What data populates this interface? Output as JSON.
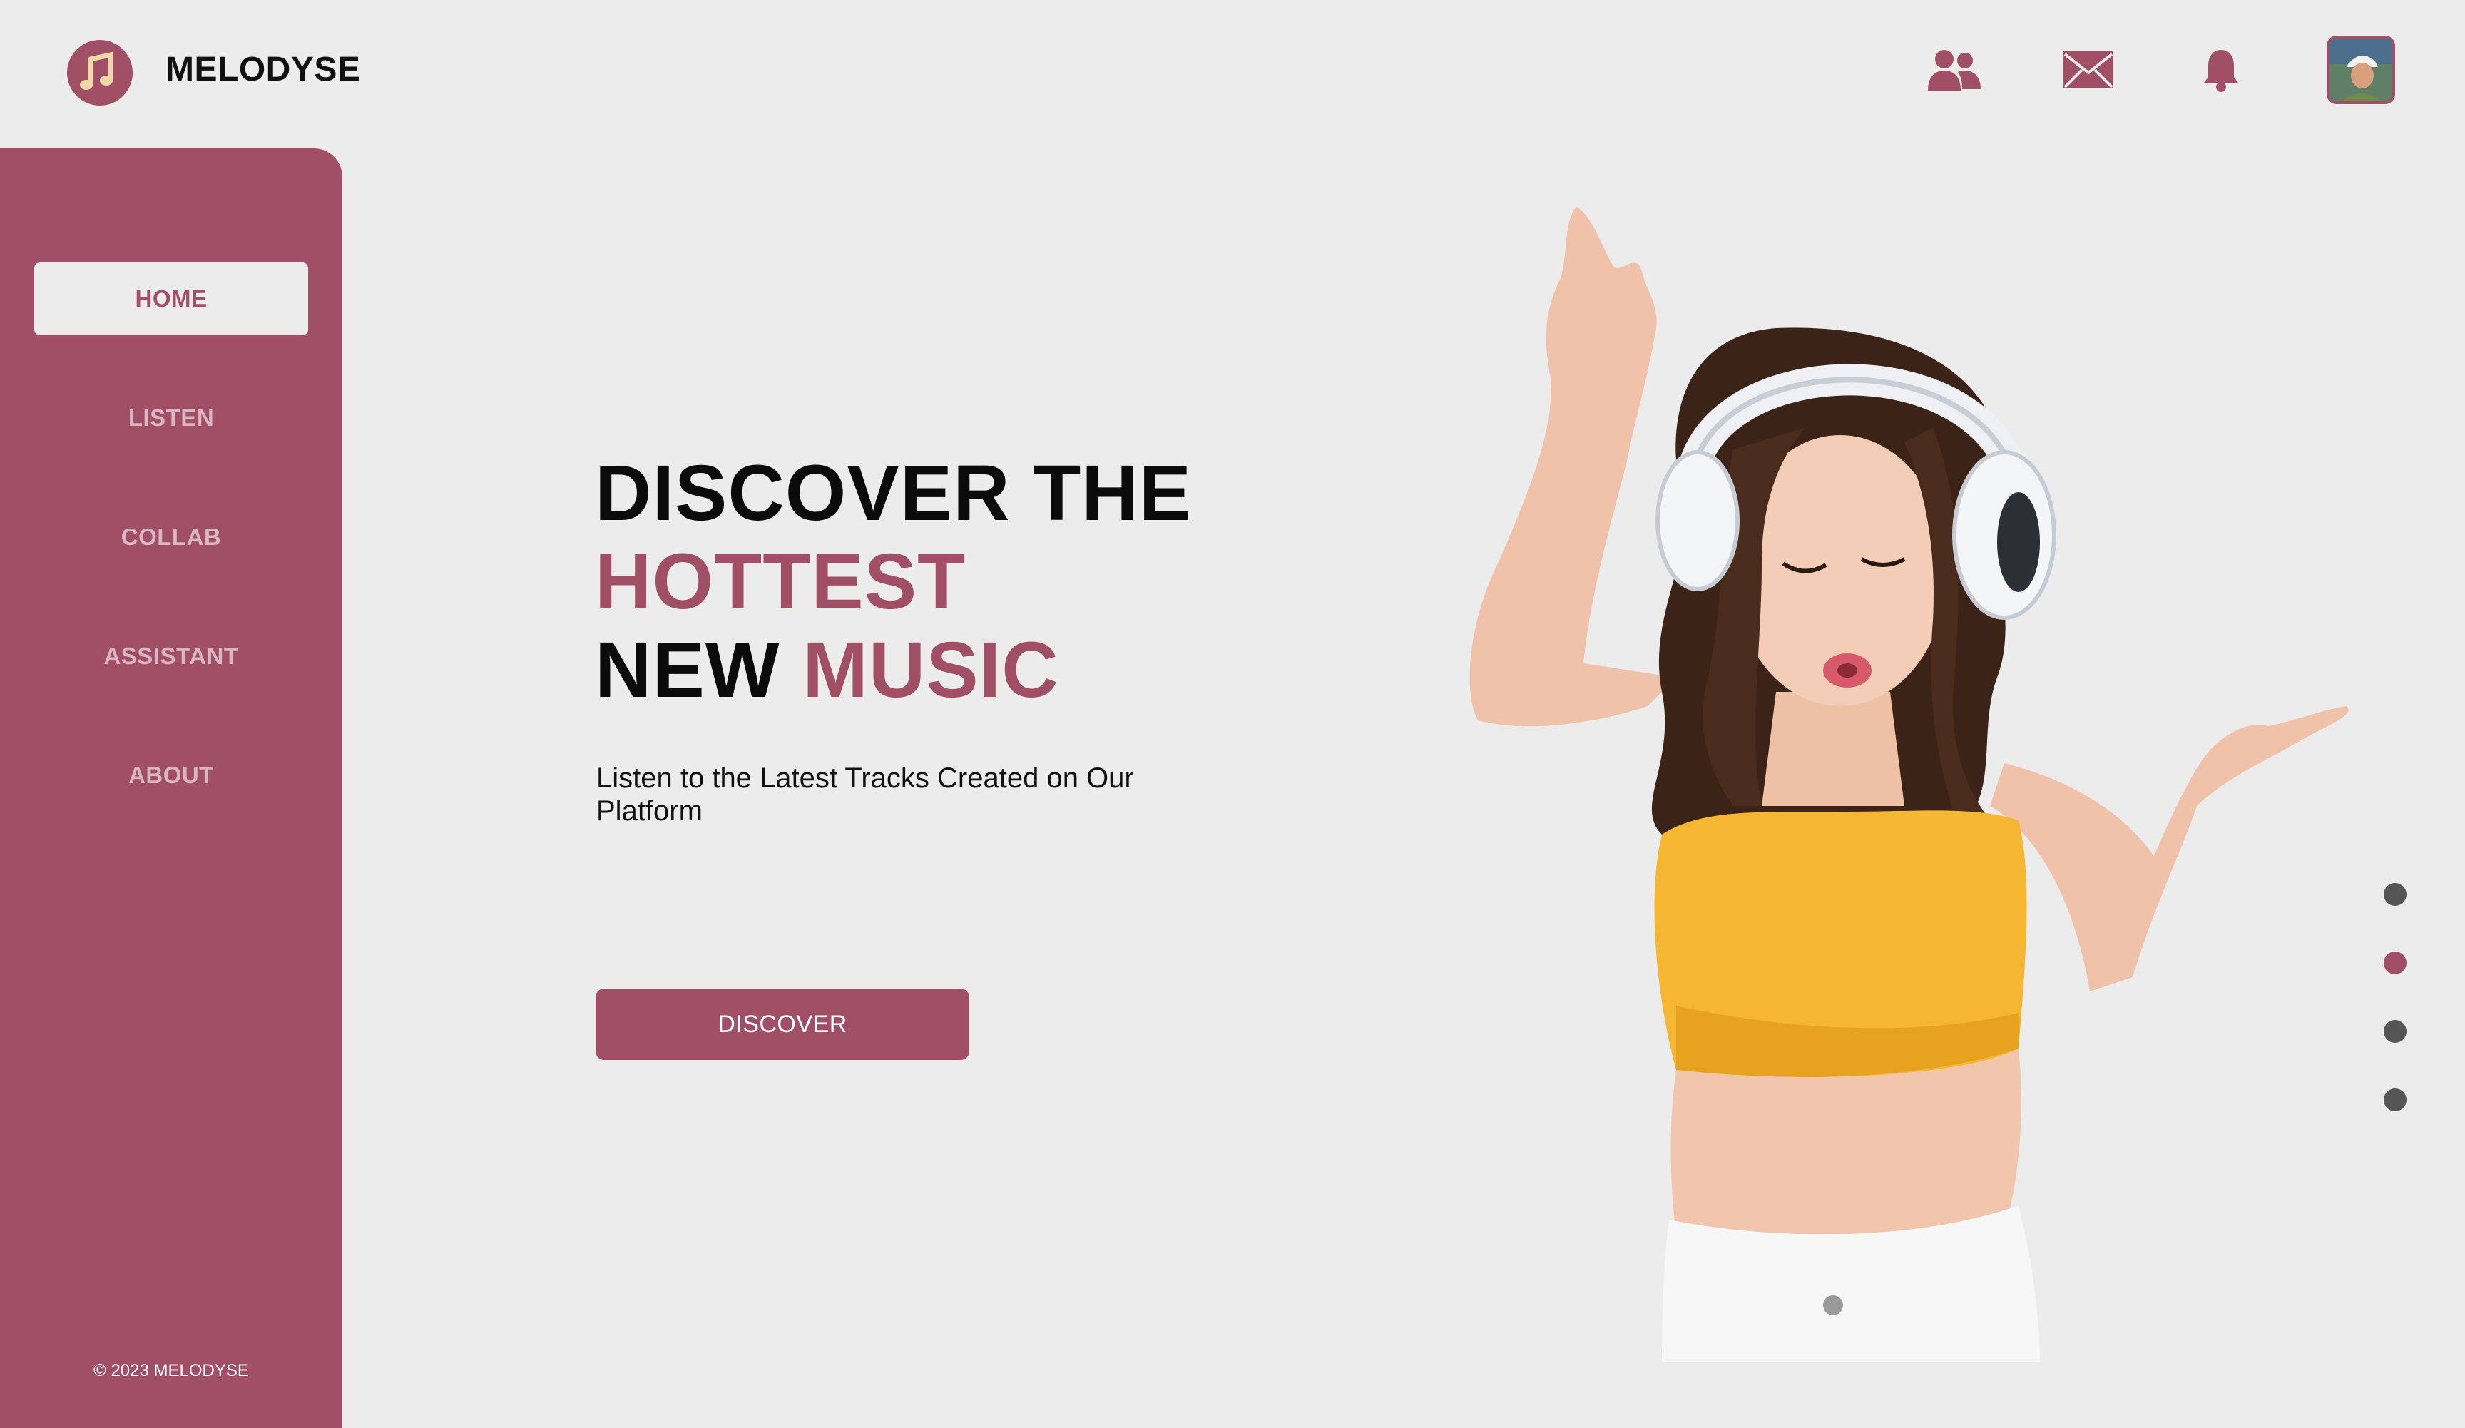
{
  "header": {
    "brand": "MELODYSE",
    "icons": [
      "users-icon",
      "mail-icon",
      "bell-icon"
    ]
  },
  "sidebar": {
    "items": [
      {
        "label": "HOME",
        "active": true
      },
      {
        "label": "LISTEN",
        "active": false
      },
      {
        "label": "COLLAB",
        "active": false
      },
      {
        "label": "ASSISTANT",
        "active": false
      },
      {
        "label": "ABOUT",
        "active": false
      }
    ],
    "copyright": "© 2023 MELODYSE"
  },
  "hero": {
    "line1": "DISCOVER THE",
    "line2": "HOTTEST",
    "line3a": "NEW",
    "line3b": "MUSIC",
    "subtitle": "Listen to the Latest Tracks Created on Our Platform",
    "button": "DISCOVER"
  },
  "carousel": {
    "dot_count": 4,
    "active_index": 1
  },
  "colors": {
    "accent": "#a14f67",
    "background": "#ececec",
    "text": "#0b0b0b",
    "nav_inactive": "#d9b6c1",
    "dot": "#555555"
  }
}
